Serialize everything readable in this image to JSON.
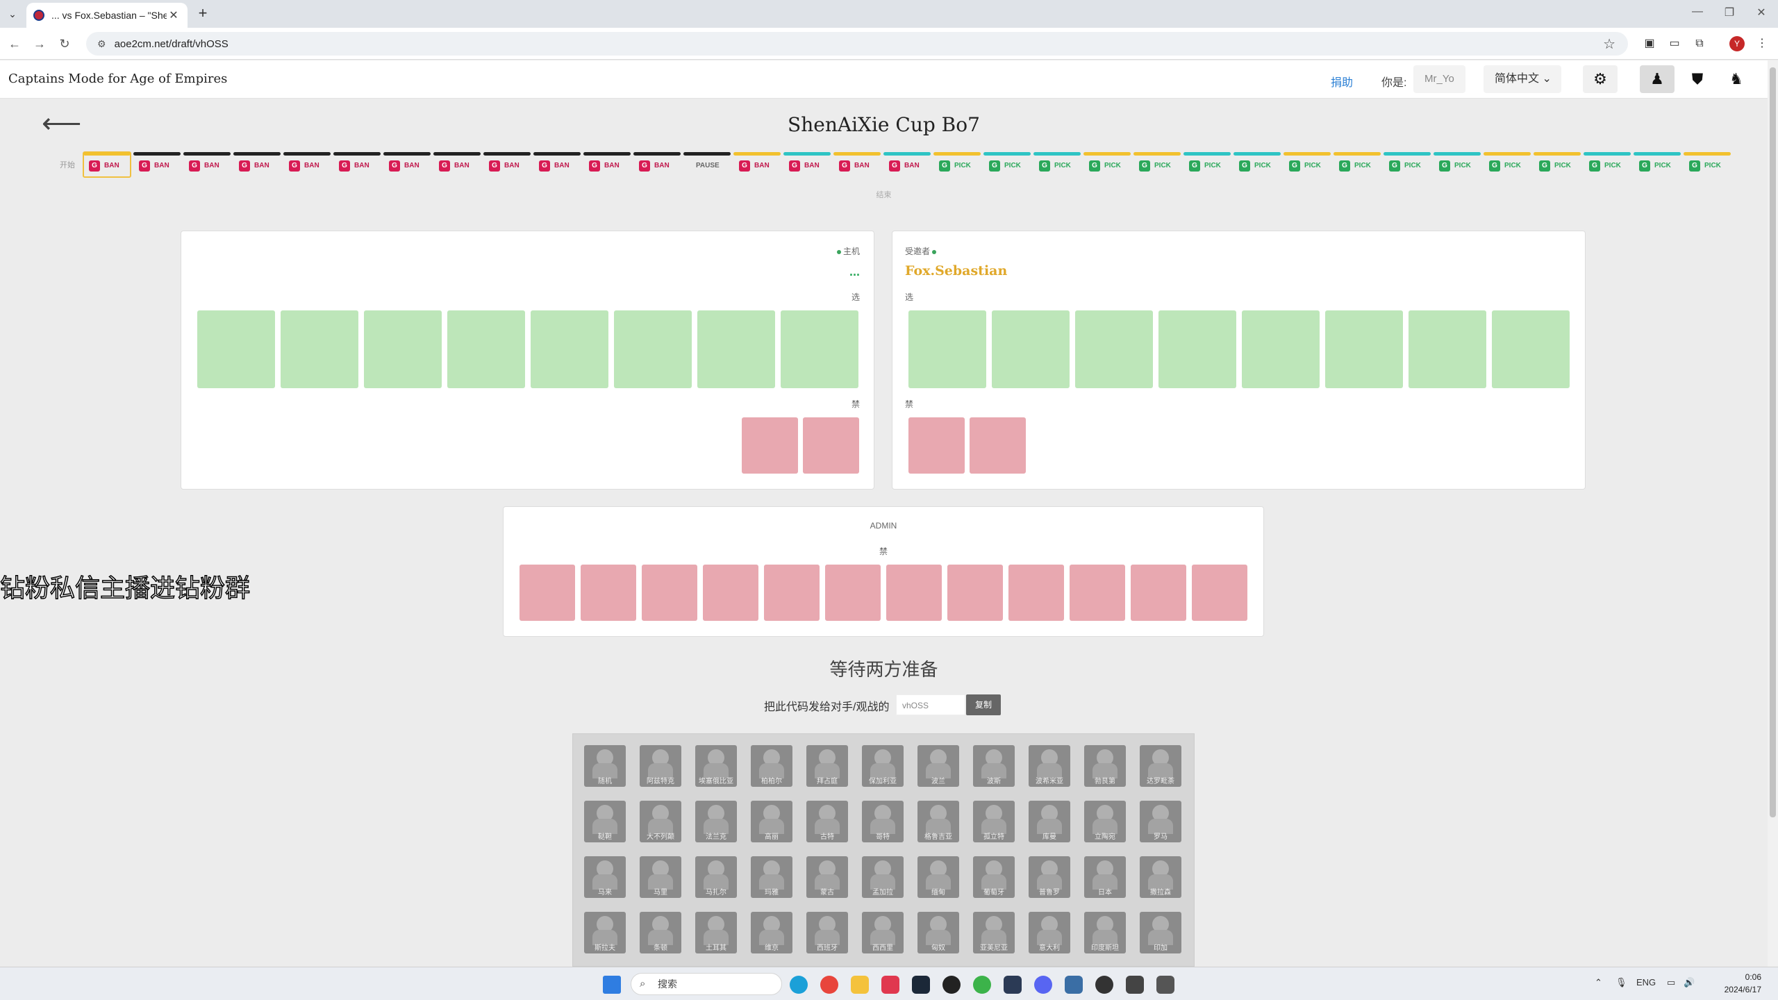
{
  "browser": {
    "tab_title": "... vs Fox.Sebastian – \"ShenAi",
    "url": "aoe2cm.net/draft/vhOSS"
  },
  "header": {
    "brand": "Captains Mode for Age of Empires",
    "donate": "捐助",
    "you_label": "你是:",
    "you_name": "Mr_Yo",
    "language": "简体中文"
  },
  "draft": {
    "title": "ShenAiXie Cup Bo7",
    "timeline_start": "开始",
    "timeline_end": "结束",
    "turns": [
      {
        "player": "host",
        "action": "BAN",
        "g": "G",
        "current": true
      },
      {
        "player": "admin",
        "action": "BAN",
        "g": "G"
      },
      {
        "player": "admin",
        "action": "BAN",
        "g": "G"
      },
      {
        "player": "admin",
        "action": "BAN",
        "g": "G"
      },
      {
        "player": "admin",
        "action": "BAN",
        "g": "G"
      },
      {
        "player": "admin",
        "action": "BAN",
        "g": "G"
      },
      {
        "player": "admin",
        "action": "BAN",
        "g": "G"
      },
      {
        "player": "admin",
        "action": "BAN",
        "g": "G"
      },
      {
        "player": "admin",
        "action": "BAN",
        "g": "G"
      },
      {
        "player": "admin",
        "action": "BAN",
        "g": "G"
      },
      {
        "player": "admin",
        "action": "BAN",
        "g": "G"
      },
      {
        "player": "admin",
        "action": "BAN",
        "g": "G"
      },
      {
        "player": "admin",
        "action": "PAUSE",
        "g": ""
      },
      {
        "player": "host",
        "action": "BAN",
        "g": "G"
      },
      {
        "player": "guest",
        "action": "BAN",
        "g": "G"
      },
      {
        "player": "host",
        "action": "BAN",
        "g": "G"
      },
      {
        "player": "guest",
        "action": "BAN",
        "g": "G"
      },
      {
        "player": "host",
        "action": "PICK",
        "g": "G"
      },
      {
        "player": "guest",
        "action": "PICK",
        "g": "G"
      },
      {
        "player": "guest",
        "action": "PICK",
        "g": "G"
      },
      {
        "player": "host",
        "action": "PICK",
        "g": "G"
      },
      {
        "player": "host",
        "action": "PICK",
        "g": "G"
      },
      {
        "player": "guest",
        "action": "PICK",
        "g": "G"
      },
      {
        "player": "guest",
        "action": "PICK",
        "g": "G"
      },
      {
        "player": "host",
        "action": "PICK",
        "g": "G"
      },
      {
        "player": "host",
        "action": "PICK",
        "g": "G"
      },
      {
        "player": "guest",
        "action": "PICK",
        "g": "G"
      },
      {
        "player": "guest",
        "action": "PICK",
        "g": "G"
      },
      {
        "player": "host",
        "action": "PICK",
        "g": "G"
      },
      {
        "player": "host",
        "action": "PICK",
        "g": "G"
      },
      {
        "player": "guest",
        "action": "PICK",
        "g": "G"
      },
      {
        "player": "guest",
        "action": "PICK",
        "g": "G"
      },
      {
        "player": "host",
        "action": "PICK",
        "g": "G"
      }
    ],
    "colors": {
      "admin": "#222222",
      "host": "#f2c12e",
      "guest": "#2ec4c4",
      "ban_text": "#c0174b",
      "pick_text": "#2aa85a",
      "g_ban": "#d81b54",
      "g_pick": "#2aa85a"
    }
  },
  "host_panel": {
    "role": "主机",
    "name": "...",
    "picks_label": "选",
    "bans_label": "禁",
    "pick_slots": 8,
    "ban_slots": 2
  },
  "guest_panel": {
    "role": "受邀者",
    "name": "Fox.Sebastian",
    "picks_label": "选",
    "bans_label": "禁",
    "pick_slots": 8,
    "ban_slots": 2
  },
  "admin_panel": {
    "role": "ADMIN",
    "bans_label": "禁",
    "ban_slots": 12
  },
  "overlay_text": "钻粉私信主播进钻粉群",
  "status": {
    "waiting": "等待两方准备",
    "code_label": "把此代码发给对手/观战的",
    "code": "vhOSS",
    "copy": "复制"
  },
  "civs": [
    "随机",
    "阿兹特克",
    "埃塞俄比亚",
    "柏柏尔",
    "拜占庭",
    "保加利亚",
    "波兰",
    "波斯",
    "波希米亚",
    "勃艮第",
    "达罗毗荼",
    "鞑靼",
    "大不列颠",
    "法兰克",
    "高丽",
    "古特",
    "哥特",
    "格鲁吉亚",
    "孤立特",
    "库曼",
    "立陶宛",
    "罗马",
    "马来",
    "马里",
    "马扎尔",
    "玛雅",
    "蒙古",
    "孟加拉",
    "缅甸",
    "葡萄牙",
    "普鲁罗",
    "日本",
    "撒拉森",
    "斯拉夫",
    "条顿",
    "土耳其",
    "维京",
    "西班牙",
    "西西里",
    "匈奴",
    "亚美尼亚",
    "意大利",
    "印度斯坦",
    "印加"
  ],
  "taskbar": {
    "search": "搜索",
    "lang": "ENG",
    "time": "0:06",
    "date": "2024/6/17"
  }
}
